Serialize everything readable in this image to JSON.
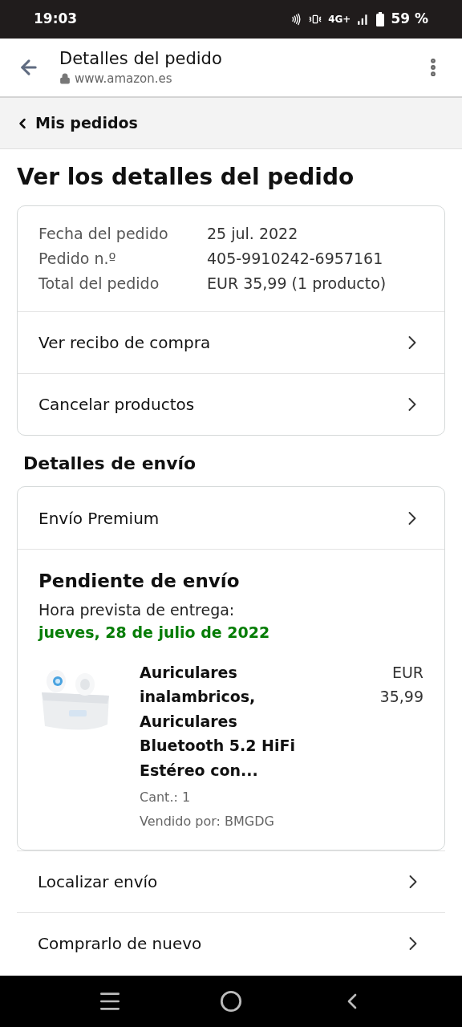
{
  "status_bar": {
    "time": "19:03",
    "network": "4G+",
    "battery": "59 %"
  },
  "browser": {
    "title": "Detalles del pedido",
    "url": "www.amazon.es"
  },
  "breadcrumb": "Mis pedidos",
  "heading": "Ver los detalles del pedido",
  "summary": [
    {
      "label": "Fecha del pedido",
      "value": "25 jul. 2022"
    },
    {
      "label": "Pedido n.º",
      "value": "405-9910242-6957161"
    },
    {
      "label": "Total del pedido",
      "value": "EUR 35,99 (1 producto)"
    }
  ],
  "order_links": [
    "Ver recibo de compra",
    "Cancelar productos"
  ],
  "shipping": {
    "heading": "Detalles de envío",
    "method": "Envío Premium",
    "status": "Pendiente de envío",
    "delivery_label": "Hora prevista de entrega:",
    "delivery_date": "jueves, 28 de julio de 2022",
    "product": {
      "kind": "picture",
      "title": "Auriculares inalambricos, Auriculares Bluetooth 5.2 HiFi Estéreo con...",
      "quantity": "Cant.: 1",
      "seller": "Vendido por: BMGDG",
      "currency": "EUR",
      "price": "35,99"
    }
  },
  "shipment_links": [
    "Localizar envío",
    "Comprarlo de nuevo"
  ]
}
